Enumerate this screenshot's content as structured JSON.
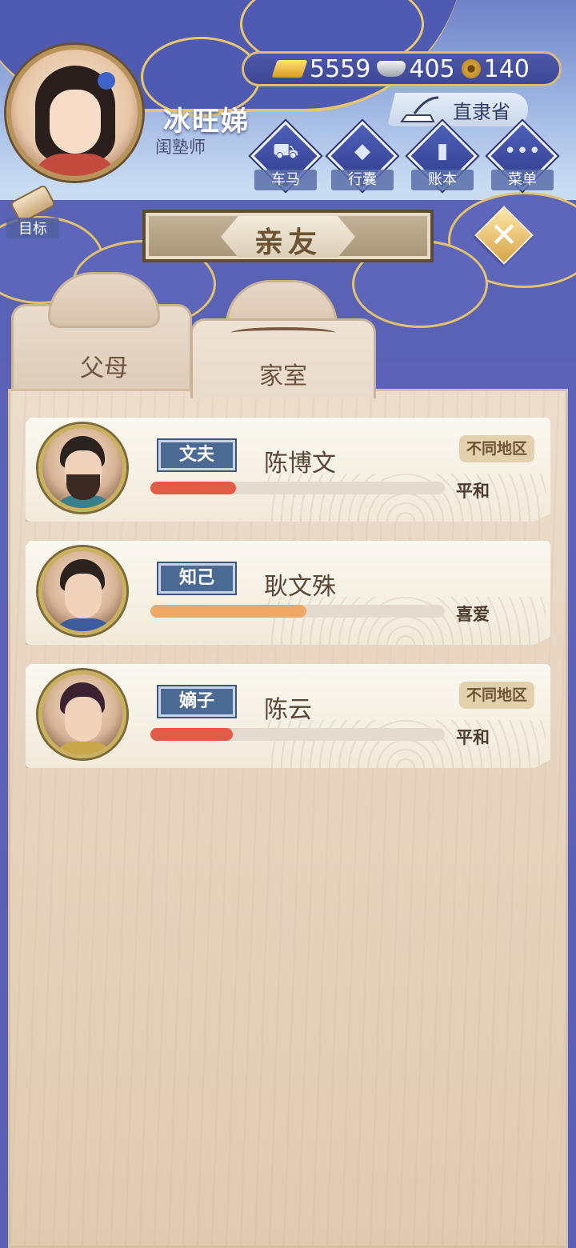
{
  "player": {
    "name": "冰旺娣",
    "title": "闺塾师"
  },
  "currency": {
    "gold": "5559",
    "silver": "405",
    "coin": "140"
  },
  "location": "直隶省",
  "menu": [
    {
      "label": "车马",
      "icon": "carriage-icon"
    },
    {
      "label": "行囊",
      "icon": "bundle-icon"
    },
    {
      "label": "账本",
      "icon": "ledger-icon"
    },
    {
      "label": "菜单",
      "icon": "more-icon"
    }
  ],
  "goal": {
    "label": "目标"
  },
  "page_title": "亲友",
  "tabs": [
    {
      "label": "父母",
      "active": false
    },
    {
      "label": "家室",
      "active": true
    }
  ],
  "relatives": [
    {
      "relation": "文夫",
      "name": "陈博文",
      "mood": "平和",
      "affinity": 0.29,
      "bar_color": "#e35a47",
      "region": "不同地区"
    },
    {
      "relation": "知己",
      "name": "耿文殊",
      "mood": "喜爱",
      "affinity": 0.53,
      "bar_color": "#f0a867",
      "region": ""
    },
    {
      "relation": "嫡子",
      "name": "陈云",
      "mood": "平和",
      "affinity": 0.28,
      "bar_color": "#e35a47",
      "region": "不同地区"
    }
  ],
  "colors": {
    "tag_bg": "#4a6993",
    "wood": "#e0c9b1",
    "sky_band": "#5a5fb5"
  }
}
